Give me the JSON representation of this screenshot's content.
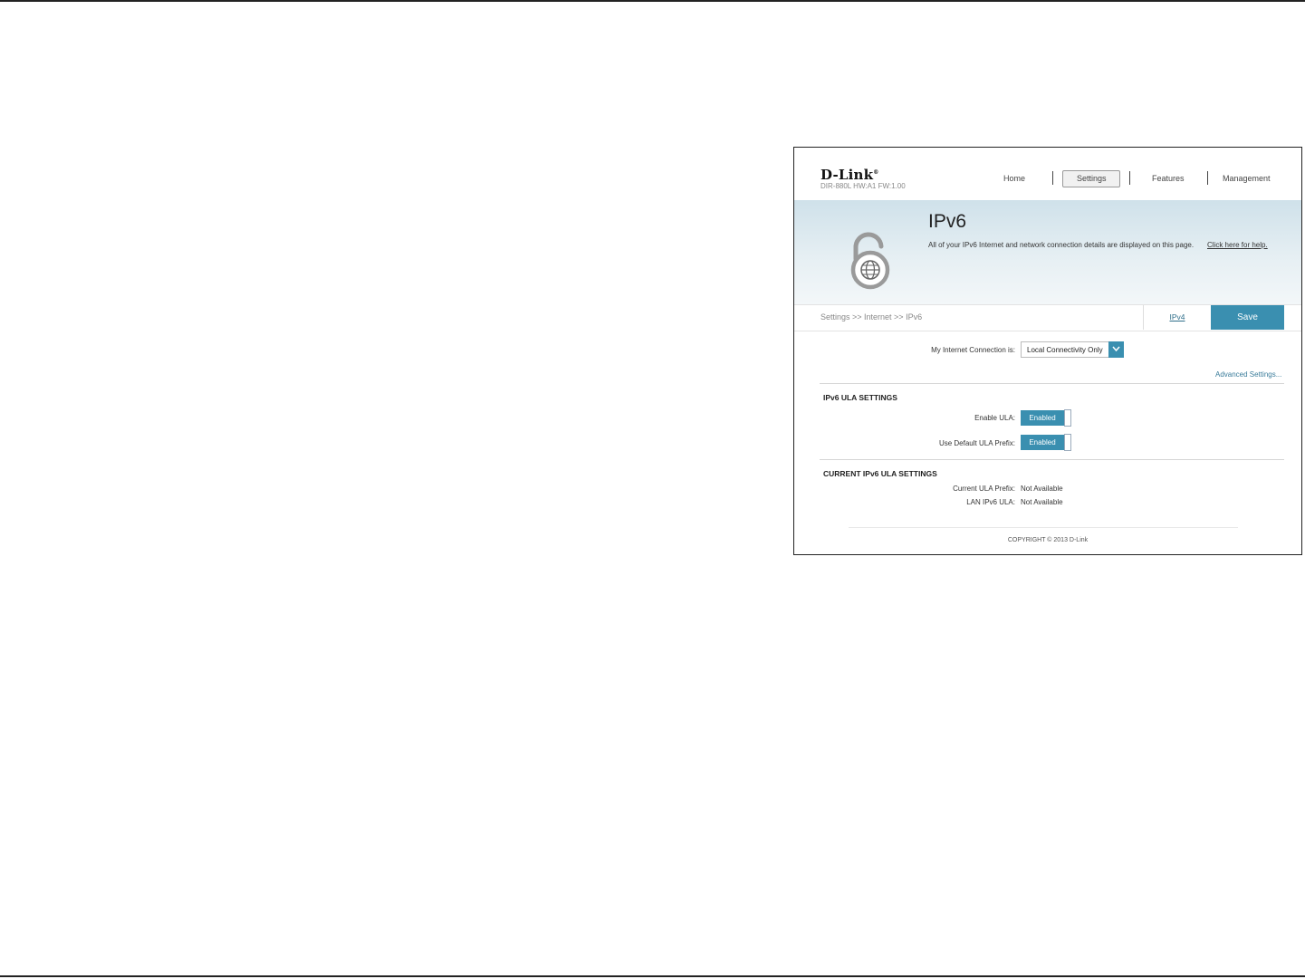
{
  "header": {
    "logo": "D-Link",
    "model": "DIR-880L   HW:A1   FW:1.00",
    "nav": [
      {
        "label": "Home"
      },
      {
        "label": "Settings"
      },
      {
        "label": "Features"
      },
      {
        "label": "Management"
      }
    ],
    "active_nav": "Settings"
  },
  "banner": {
    "title": "IPv6",
    "description": "All of your IPv6 Internet and network connection details are displayed on this page.",
    "help_link": "Click here for help."
  },
  "breadcrumb": "Settings >> Internet >> IPv6",
  "tabs": {
    "ipv4_label": "IPv4",
    "save_label": "Save"
  },
  "connection": {
    "label": "My Internet Connection is:",
    "value": "Local Connectivity Only"
  },
  "advanced_link": "Advanced Settings...",
  "ula_settings": {
    "title": "IPv6 ULA SETTINGS",
    "enable_ula_label": "Enable ULA:",
    "enable_ula_value": "Enabled",
    "default_prefix_label": "Use Default ULA Prefix:",
    "default_prefix_value": "Enabled"
  },
  "current_ula": {
    "title": "CURRENT IPv6 ULA SETTINGS",
    "prefix_label": "Current ULA Prefix:",
    "prefix_value": "Not Available",
    "lan_label": "LAN IPv6 ULA:",
    "lan_value": "Not Available"
  },
  "footer": "COPYRIGHT © 2013 D-Link",
  "colors": {
    "accent": "#3a8fb0",
    "banner": "#cfe1ea"
  }
}
